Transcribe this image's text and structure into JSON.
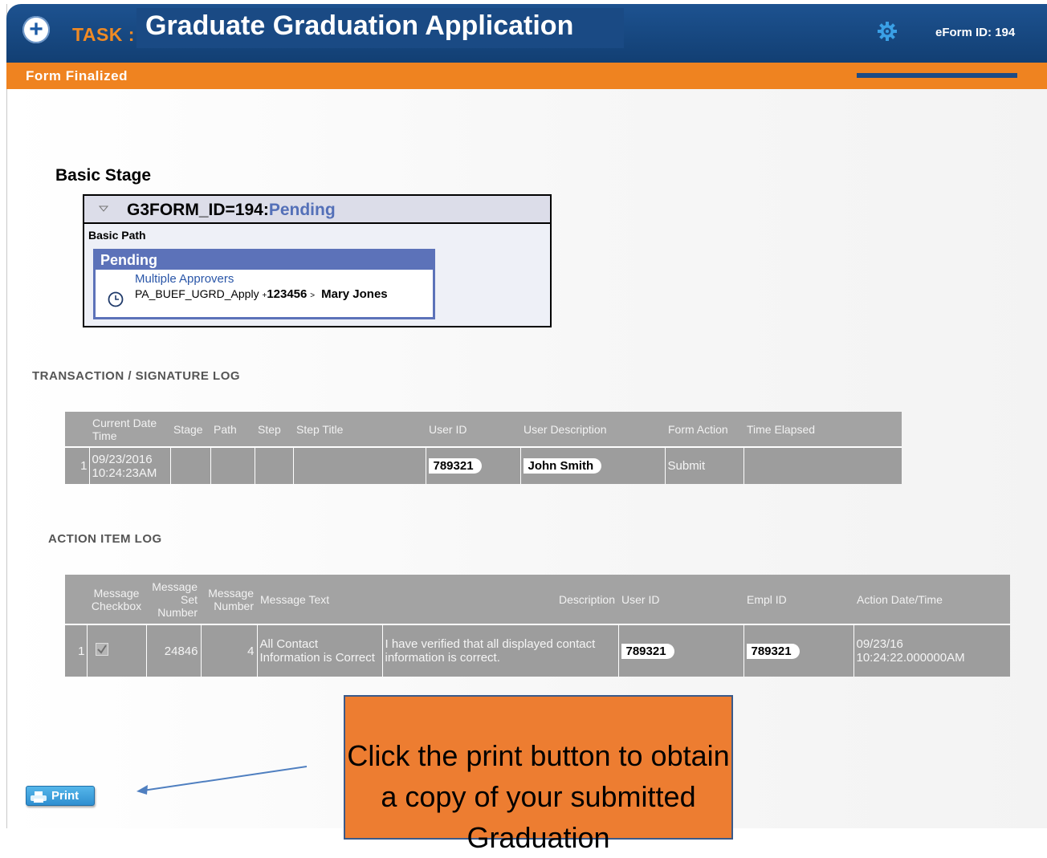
{
  "header": {
    "task_label": "TASK :",
    "title": "Graduate Graduation Application",
    "eform_id": "eForm ID: 194",
    "status": "Form Finalized"
  },
  "basic_stage": {
    "heading": "Basic Stage",
    "form_id": "G3FORM_ID=194:",
    "form_status": "Pending",
    "path_label": "Basic Path",
    "pending_label": "Pending",
    "approvers_link": "Multiple Approvers",
    "apply_text": "PA_BUEF_UGRD_Apply",
    "apply_id": "123456",
    "apply_name": "Mary Jones"
  },
  "transaction_log": {
    "title": "TRANSACTION / SIGNATURE LOG",
    "headers": [
      "Current Date Time",
      "Stage",
      "Path",
      "Step",
      "Step Title",
      "User ID",
      "User Description",
      "Form Action",
      "Time Elapsed"
    ],
    "rows": [
      {
        "num": "1",
        "date": "09/23/2016 10:24:23AM",
        "stage": "",
        "path": "",
        "step": "",
        "step_title": "",
        "user_id": "789321",
        "user_description": "John Smith",
        "form_action": "Submit",
        "time_elapsed": ""
      }
    ]
  },
  "action_log": {
    "title": "ACTION ITEM LOG",
    "headers": [
      "Message Checkbox",
      "Message Set Number",
      "Message Number",
      "Message Text",
      "Description",
      "User ID",
      "Empl ID",
      "Action Date/Time"
    ],
    "rows": [
      {
        "num": "1",
        "checked": true,
        "set_number": "24846",
        "message_number": "4",
        "message_text": "All Contact Information is Correct",
        "description": "I have verified that all displayed contact information is correct.",
        "user_id": "789321",
        "empl_id": "789321",
        "action_datetime": "09/23/16 10:24:22.000000AM"
      }
    ]
  },
  "print_button": {
    "label": "Print"
  },
  "callout": {
    "text": "Click the print button to obtain a copy of your submitted Graduation"
  },
  "colors": {
    "header_blue": "#1d5290",
    "status_orange": "#ef8320",
    "pending_blue": "#5c72b9",
    "callout_orange": "#ed7d31"
  },
  "icons": [
    "plus-icon",
    "gear-icon",
    "collapse-caret-icon",
    "clock-icon",
    "checkbox-checked-icon",
    "printer-icon",
    "arrow-icon"
  ]
}
